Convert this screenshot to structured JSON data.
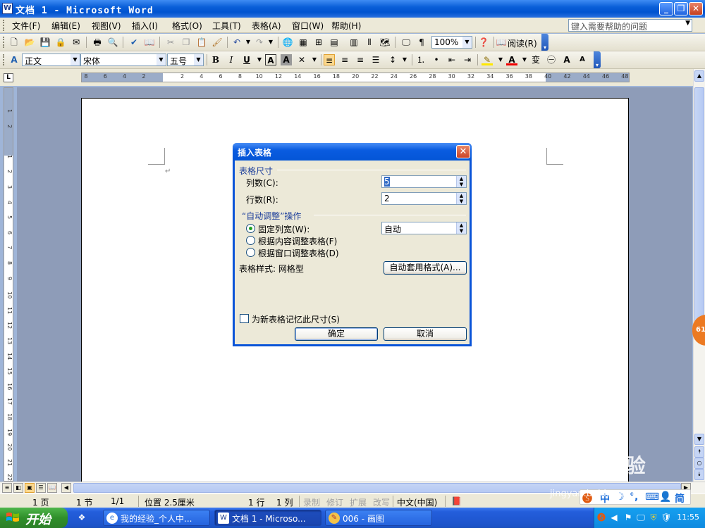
{
  "window": {
    "title": "文档 1 - Microsoft Word",
    "icon": "W"
  },
  "menu": [
    "文件(F)",
    "编辑(E)",
    "视图(V)",
    "插入(I)",
    "格式(O)",
    "工具(T)",
    "表格(A)",
    "窗口(W)",
    "帮助(H)"
  ],
  "help_box": {
    "placeholder": "键入需要帮助的问题"
  },
  "standard_toolbar": {
    "zoom": "100%",
    "read_label": "阅读(R)"
  },
  "formatting_toolbar": {
    "style": "正文",
    "font": "宋体",
    "size": "五号"
  },
  "ruler": {
    "h_ticks": [
      "8",
      "6",
      "4",
      "2",
      "",
      "2",
      "4",
      "6",
      "8",
      "10",
      "12",
      "14",
      "16",
      "18",
      "20",
      "22",
      "24",
      "26",
      "28",
      "30",
      "32",
      "34",
      "36",
      "38",
      "40",
      "42",
      "44",
      "46",
      "48"
    ],
    "v_ticks": [
      "1",
      "2",
      "",
      "1",
      "2",
      "3",
      "4",
      "5",
      "6",
      "7",
      "8",
      "9",
      "10",
      "11",
      "12",
      "13",
      "14",
      "15",
      "16",
      "17",
      "18",
      "19",
      "20",
      "21",
      "22"
    ]
  },
  "dialog": {
    "title": "插入表格",
    "size_group": "表格尺寸",
    "cols_label": "列数(C):",
    "cols_value": "5",
    "rows_label": "行数(R):",
    "rows_value": "2",
    "autofit_group": "“自动调整”操作",
    "opt_fixed": "固定列宽(W):",
    "fixed_value": "自动",
    "opt_content": "根据内容调整表格(F)",
    "opt_window": "根据窗口调整表格(D)",
    "style_label": "表格样式: 网格型",
    "autoformat_button": "自动套用格式(A)...",
    "remember_label": "为新表格记忆此尺寸(S)",
    "ok_button": "确定",
    "cancel_button": "取消"
  },
  "status": {
    "page": "1 页",
    "section": "1 节",
    "pages": "1/1",
    "position": "位置 2.5厘米",
    "line": "1 行",
    "col": "1 列",
    "rec": "录制",
    "trk": "修订",
    "ext": "扩展",
    "ovr": "改写",
    "lang": "中文(中国)"
  },
  "taskbar": {
    "start": "开始",
    "tasks": [
      "我的经验_个人中...",
      "文档 1 - Microso...",
      "006 - 画图"
    ],
    "clock": "11:55"
  },
  "ime": {
    "label1": "中",
    "label2": "简"
  },
  "watermark": {
    "logo": "Baidu经验",
    "url": "jingyan.baidu.com"
  },
  "side_badge": "61"
}
